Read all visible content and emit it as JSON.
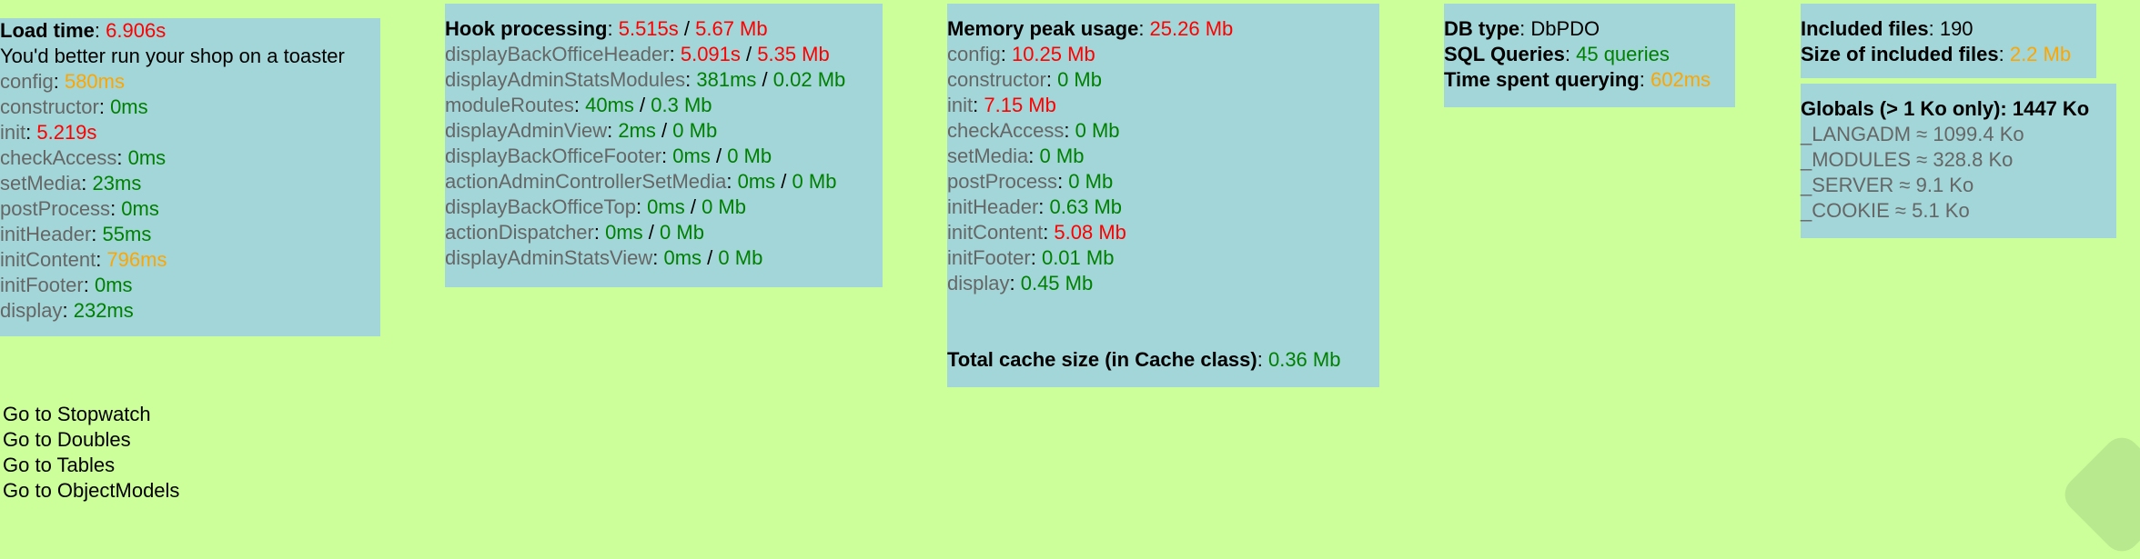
{
  "load": {
    "label": "Load time",
    "value": "6.906s",
    "note": "You'd better run your shop on a toaster",
    "items": [
      {
        "name": "config",
        "value": "580ms",
        "color": "orange"
      },
      {
        "name": "constructor",
        "value": "0ms",
        "color": "green"
      },
      {
        "name": "init",
        "value": "5.219s",
        "color": "red"
      },
      {
        "name": "checkAccess",
        "value": "0ms",
        "color": "green"
      },
      {
        "name": "setMedia",
        "value": "23ms",
        "color": "green"
      },
      {
        "name": "postProcess",
        "value": "0ms",
        "color": "green"
      },
      {
        "name": "initHeader",
        "value": "55ms",
        "color": "green"
      },
      {
        "name": "initContent",
        "value": "796ms",
        "color": "orange"
      },
      {
        "name": "initFooter",
        "value": "0ms",
        "color": "green"
      },
      {
        "name": "display",
        "value": "232ms",
        "color": "green"
      }
    ]
  },
  "hooks": {
    "label": "Hook processing",
    "time": "5.515s",
    "memory": "5.67 Mb",
    "items": [
      {
        "name": "displayBackOfficeHeader",
        "time": "5.091s",
        "memory": "5.35 Mb",
        "color": "red"
      },
      {
        "name": "displayAdminStatsModules",
        "time": "381ms",
        "memory": "0.02 Mb",
        "color": "green"
      },
      {
        "name": "moduleRoutes",
        "time": "40ms",
        "memory": "0.3 Mb",
        "color": "green"
      },
      {
        "name": "displayAdminView",
        "time": "2ms",
        "memory": "0 Mb",
        "color": "green"
      },
      {
        "name": "displayBackOfficeFooter",
        "time": "0ms",
        "memory": "0 Mb",
        "color": "green"
      },
      {
        "name": "actionAdminControllerSetMedia",
        "time": "0ms",
        "memory": "0 Mb",
        "color": "green"
      },
      {
        "name": "displayBackOfficeTop",
        "time": "0ms",
        "memory": "0 Mb",
        "color": "green"
      },
      {
        "name": "actionDispatcher",
        "time": "0ms",
        "memory": "0 Mb",
        "color": "green"
      },
      {
        "name": "displayAdminStatsView",
        "time": "0ms",
        "memory": "0 Mb",
        "color": "green"
      }
    ]
  },
  "memory": {
    "label": "Memory peak usage",
    "value": "25.26 Mb",
    "items": [
      {
        "name": "config",
        "value": "10.25 Mb",
        "color": "red"
      },
      {
        "name": "constructor",
        "value": "0 Mb",
        "color": "green"
      },
      {
        "name": "init",
        "value": "7.15 Mb",
        "color": "red"
      },
      {
        "name": "checkAccess",
        "value": "0 Mb",
        "color": "green"
      },
      {
        "name": "setMedia",
        "value": "0 Mb",
        "color": "green"
      },
      {
        "name": "postProcess",
        "value": "0 Mb",
        "color": "green"
      },
      {
        "name": "initHeader",
        "value": "0.63 Mb",
        "color": "green"
      },
      {
        "name": "initContent",
        "value": "5.08 Mb",
        "color": "red"
      },
      {
        "name": "initFooter",
        "value": "0.01 Mb",
        "color": "green"
      },
      {
        "name": "display",
        "value": "0.45 Mb",
        "color": "green"
      }
    ],
    "cache_label": "Total cache size (in Cache class)",
    "cache_value": "0.36 Mb"
  },
  "db": {
    "type_label": "DB type",
    "type_value": "DbPDO",
    "queries_label": "SQL Queries",
    "queries_value": "45 queries",
    "time_label": "Time spent querying",
    "time_value": "602ms"
  },
  "files": {
    "included_label": "Included files",
    "included_value": "190",
    "size_label": "Size of included files",
    "size_value": "2.2 Mb"
  },
  "globals": {
    "header": "Globals (> 1 Ko only): 1447 Ko",
    "items": [
      "_LANGADM ≈ 1099.4 Ko",
      "_MODULES ≈ 328.8 Ko",
      "_SERVER ≈ 9.1 Ko",
      "_COOKIE ≈ 5.1 Ko"
    ]
  },
  "links": [
    "Go to Stopwatch",
    "Go to Doubles",
    "Go to Tables",
    "Go to ObjectModels"
  ],
  "colors": {
    "red": "#ff0000",
    "orange": "#ffa500",
    "green": "#008000",
    "panel": "#a2d6d8",
    "background": "#ccff99"
  }
}
